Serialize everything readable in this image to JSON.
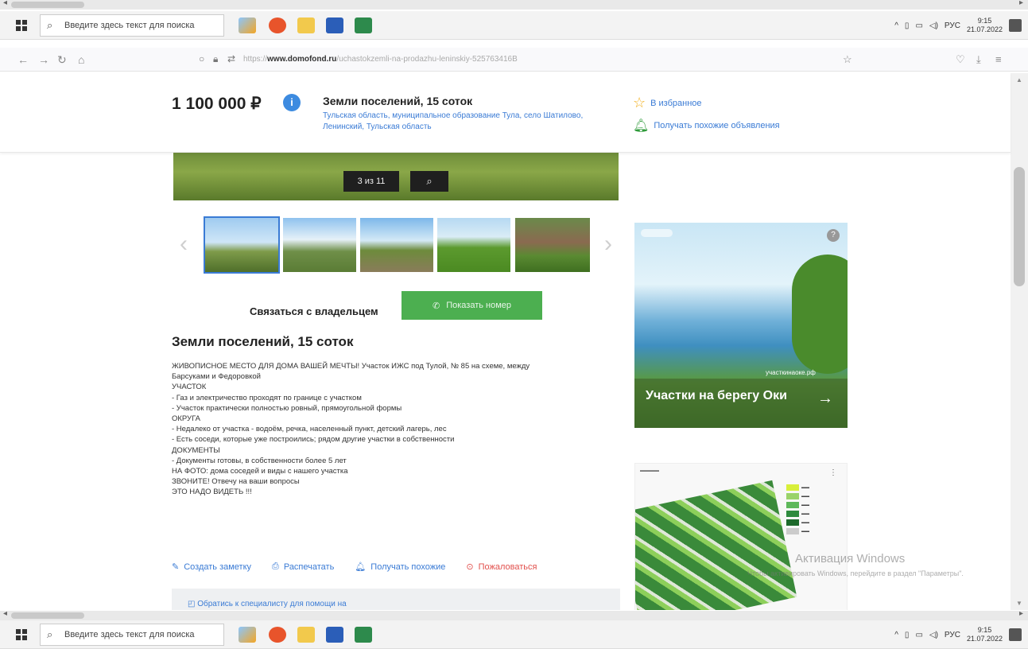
{
  "taskbar": {
    "search_placeholder": "Введите здесь текст для поиска",
    "time": "9:15",
    "date": "21.07.2022",
    "lang": "РУС"
  },
  "browser": {
    "url_domain": "www.domofond.ru",
    "url_prefix": "https://",
    "url_path": "/uchastokzemli-na-prodazhu-leninskiy-525763416B"
  },
  "listing": {
    "price": "1 100 000 ₽",
    "title": "Земли поселений, 15 соток",
    "address": "Тульская область, муниципальное образование Тула, село Шатилово, Ленинский, Тульская область",
    "favorite_label": "В избранное",
    "similar_label": "Получать похожие объявления",
    "photo_counter": "3 из 11",
    "contact_label": "Связаться с владельцем",
    "show_number": "Показать номер",
    "description_title": "Земли поселений, 15 соток",
    "description_lines": [
      "ЖИВОПИСНОЕ МЕСТО ДЛЯ ДОМА ВАШЕЙ МЕЧТЫ! Участок ИЖС под Тулой, № 85 на схеме, между",
      "Барсуками и Федоровкой",
      "УЧАСТОК",
      "- Газ и электричество проходят по границе с участком",
      "- Участок практически полностью ровный, прямоугольной формы",
      "ОКРУГА",
      "- Недалеко от участка - водоём, речка, населенный пункт, детский лагерь, лес",
      "- Есть соседи, которые уже построились; рядом другие участки в собственности",
      "ДОКУМЕНТЫ",
      "- Документы готовы, в собственности более 5 лет",
      "НА ФОТО: дома соседей и виды с нашего участка",
      "ЗВОНИТЕ! Отвечу на ваши вопросы",
      "ЭТО НАДО ВИДЕТЬ !!!"
    ],
    "actions": {
      "note": "Создать заметку",
      "print": "Распечатать",
      "similar": "Получать похожие",
      "report": "Пожаловаться"
    },
    "bottom_link": "Обратись к специалисту для помощи на"
  },
  "ads": {
    "ad1_caption": "Участки на берегу Оки",
    "ad1_site": "участкинаоке.рф"
  },
  "watermark": {
    "title": "Активация Windows",
    "subtitle": "Чтобы активировать Windows, перейдите в раздел \"Параметры\"."
  },
  "colors": {
    "accent": "#3a7bd5",
    "green_button": "#4caf50",
    "report": "#e2504c"
  }
}
